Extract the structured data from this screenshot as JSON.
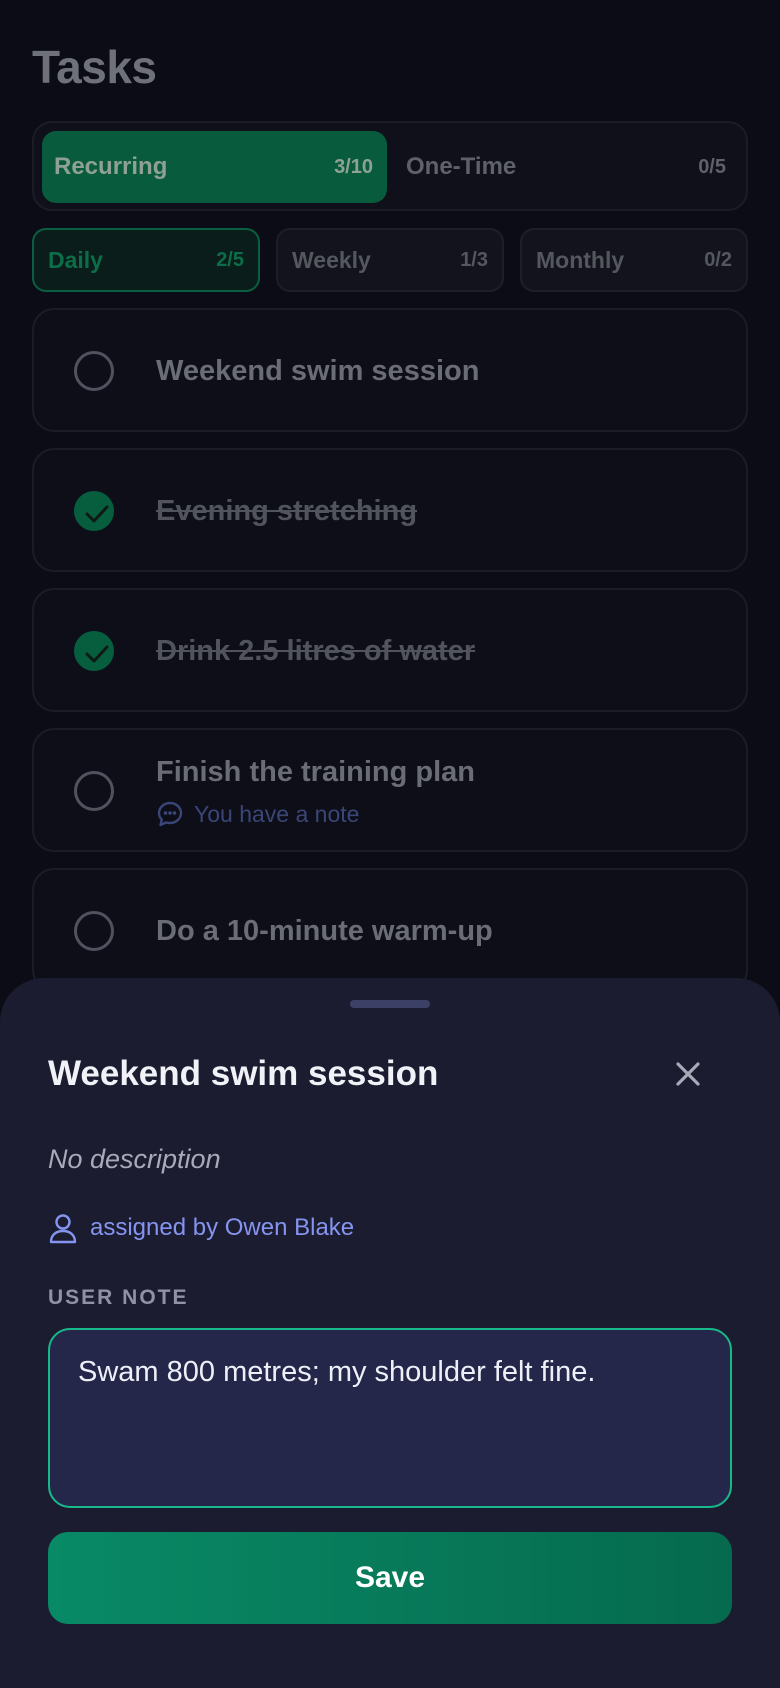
{
  "page": {
    "title": "Tasks"
  },
  "segments": [
    {
      "label": "Recurring",
      "count": "3/10",
      "active": true
    },
    {
      "label": "One-Time",
      "count": "0/5",
      "active": false
    }
  ],
  "subtabs": [
    {
      "label": "Daily",
      "count": "2/5",
      "active": true
    },
    {
      "label": "Weekly",
      "count": "1/3",
      "active": false
    },
    {
      "label": "Monthly",
      "count": "0/2",
      "active": false
    }
  ],
  "tasks": [
    {
      "title": "Weekend swim session",
      "done": false
    },
    {
      "title": "Evening stretching",
      "done": true
    },
    {
      "title": "Drink 2.5 litres of water",
      "done": true
    },
    {
      "title": "Finish the training plan",
      "done": false,
      "note": "You have a note",
      "note_icon": "chat-bubble-icon"
    },
    {
      "title": "Do a 10-minute warm-up",
      "done": false
    }
  ],
  "sheet": {
    "title": "Weekend swim session",
    "close_icon": "close-icon",
    "description": "No description",
    "assigned_icon": "user-icon",
    "assigned": "assigned by Owen Blake",
    "note_label": "USER NOTE",
    "note_value": "Swam 800 metres; my shoulder felt fine.",
    "save_label": "Save"
  },
  "colors": {
    "accent_green": "#088a66",
    "link_blue": "#8595ef",
    "sheet_bg": "#1b1c30",
    "page_bg": "#0b0c16"
  }
}
